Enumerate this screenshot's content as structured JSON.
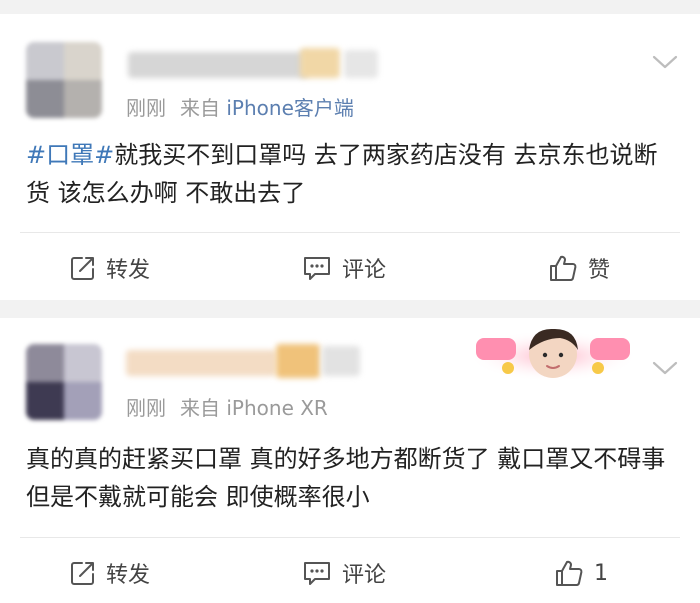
{
  "posts": [
    {
      "time": "刚刚",
      "source_prefix": "来自",
      "client": "iPhone客户端",
      "hashtag": "#口罩#",
      "text": "就我买不到口罩吗 去了两家药店没有 去京东也说断货 该怎么办啊 不敢出去了",
      "actions": {
        "repost": "转发",
        "comment": "评论",
        "like": "赞"
      }
    },
    {
      "time": "刚刚",
      "source_prefix": "来自",
      "client": "iPhone XR",
      "text": "真的真的赶紧买口罩 真的好多地方都断货了 戴口罩又不碍事 但是不戴就可能会 即使概率很小",
      "actions": {
        "repost": "转发",
        "comment": "评论",
        "like": "1"
      }
    }
  ],
  "icons": [
    "repost-icon",
    "comment-icon",
    "like-icon",
    "chevron-down-icon"
  ],
  "colors": {
    "link": "#3f78b8",
    "client": "#5c7fb0",
    "meta": "#9a9a9a",
    "background": "#f2f2f2"
  }
}
